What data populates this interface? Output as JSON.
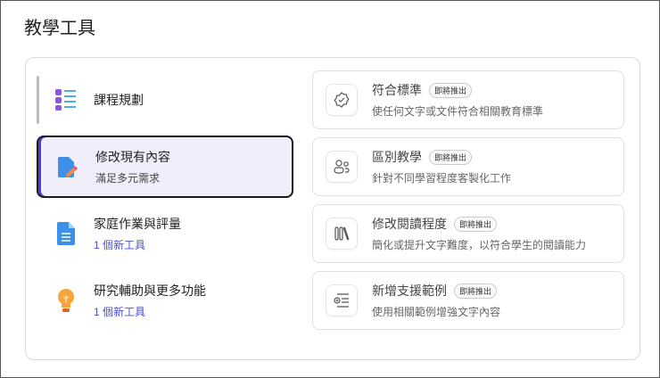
{
  "title": "教學工具",
  "categories": [
    {
      "label": "課程規劃",
      "icon": "list-icon"
    },
    {
      "label": "修改現有內容",
      "sub": "滿足多元需求",
      "icon": "edit-document-icon",
      "selected": true
    },
    {
      "label": "家庭作業與評量",
      "sub": "1 個新工具",
      "icon": "document-icon"
    },
    {
      "label": "研究輔助與更多功能",
      "sub": "1 個新工具",
      "icon": "lightbulb-icon"
    }
  ],
  "tools": [
    {
      "label": "符合標準",
      "badge": "即將推出",
      "desc": "使任何文字或文件符合相關教育標準",
      "icon": "badge-check-icon"
    },
    {
      "label": "區別教學",
      "badge": "即將推出",
      "desc": "針對不同學習程度客製化工作",
      "icon": "people-icon"
    },
    {
      "label": "修改閱讀程度",
      "badge": "即將推出",
      "desc": "簡化或提升文字難度，以符合學生的閱讀能力",
      "icon": "books-icon"
    },
    {
      "label": "新增支援範例",
      "badge": "即將推出",
      "desc": "使用相關範例增強文字內容",
      "icon": "add-list-icon"
    }
  ]
}
